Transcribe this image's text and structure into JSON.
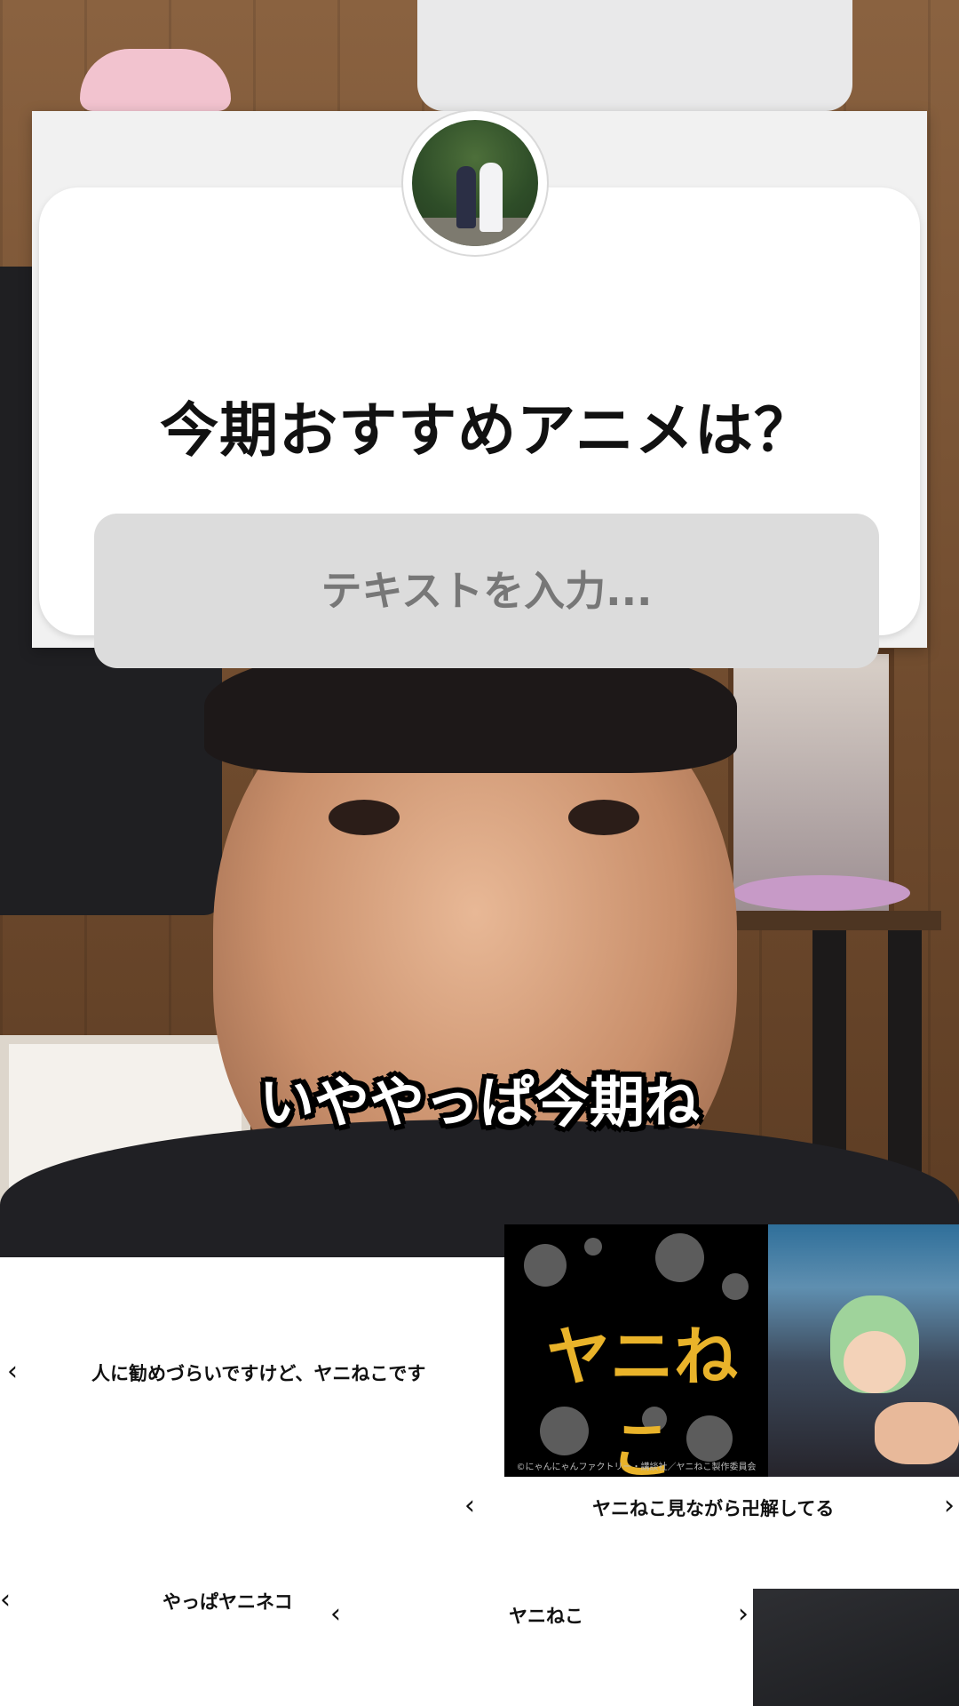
{
  "question_sticker": {
    "question": "今期おすすめアニメは？",
    "placeholder": "テキストを入力..."
  },
  "caption": "いややっぱ今期ね",
  "replies": [
    {
      "text": "人に勧めづらいですけど、ヤニねこです",
      "prev_icon": "‹"
    },
    {
      "text": "ヤニねこ見ながら卍解してる",
      "prev_icon": "‹",
      "next_icon": "›"
    },
    {
      "text": "やっぱヤニネコ",
      "prev_icon": "‹"
    },
    {
      "text": "ヤニねこ",
      "prev_icon": "‹",
      "next_icon": "›"
    }
  ],
  "anime_card": {
    "title": "ヤニねこ",
    "copyright": "©にゃんにゃんファクトリー・講談社／ヤニねこ製作委員会"
  }
}
